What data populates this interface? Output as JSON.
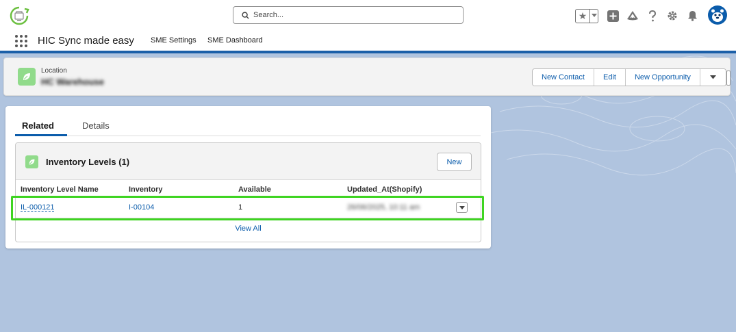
{
  "header": {
    "search_placeholder": "Search..."
  },
  "app_nav": {
    "app_name": "HIC Sync made easy",
    "items": [
      "SME Settings",
      "SME Dashboard"
    ]
  },
  "record": {
    "type": "Location",
    "name": "HC Warehouse",
    "actions": [
      "New Contact",
      "Edit",
      "New Opportunity"
    ]
  },
  "tabs": [
    "Related",
    "Details"
  ],
  "related_list": {
    "title": "Inventory Levels (1)",
    "new_label": "New",
    "columns": [
      "Inventory Level Name",
      "Inventory",
      "Available",
      "Updated_At(Shopify)"
    ],
    "rows": [
      [
        "IL-000121",
        "I-00104",
        "1",
        "26/06/2025, 10:11 am"
      ]
    ],
    "view_all": "View All"
  },
  "colors": {
    "brand_blue": "#0b5cab",
    "nav_underline": "#1b5fa8",
    "record_icon_green": "#91db8b",
    "highlight_green": "#3ed421",
    "background": "#b0c4df"
  }
}
